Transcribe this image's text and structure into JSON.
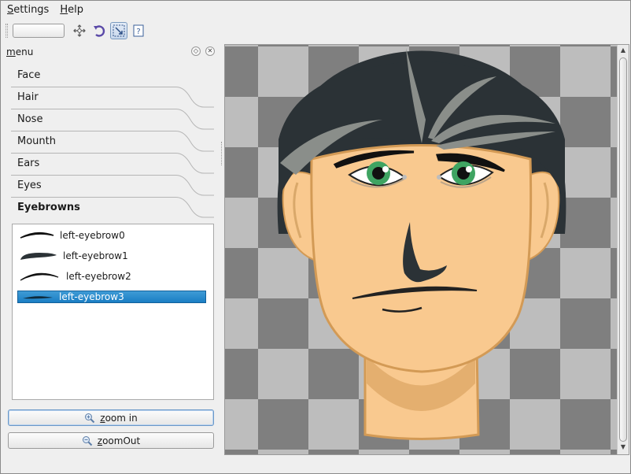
{
  "menubar": {
    "items": [
      "Settings",
      "Help"
    ]
  },
  "toolbar": {
    "combo_value": "",
    "icons": [
      "move-icon",
      "rotate-icon",
      "fit-selection-icon",
      "whats-this-icon"
    ]
  },
  "dock": {
    "title": "menu",
    "tabs": [
      {
        "label": "Face"
      },
      {
        "label": "Hair"
      },
      {
        "label": "Nose"
      },
      {
        "label": "Mounth"
      },
      {
        "label": "Ears"
      },
      {
        "label": "Eyes"
      },
      {
        "label": "Eyebrowns"
      }
    ],
    "active_tab": "Eyebrowns",
    "eyebrows": [
      {
        "label": "left-eyebrow0"
      },
      {
        "label": "left-eyebrow1"
      },
      {
        "label": "left-eyebrow2"
      },
      {
        "label": "left-eyebrow3"
      }
    ],
    "selected_eyebrow": "left-eyebrow3",
    "zoom_in_label": "zoom in",
    "zoom_out_label": "zoomOut"
  },
  "colors": {
    "hair": "#2b3236",
    "hair_highlight": "#8a8e8a",
    "skin": "#f9c98f",
    "skin_outline": "#d39a55",
    "iris": "#3fa462",
    "checker_dark": "#7f7f7f",
    "checker_light": "#bdbdbd",
    "selection": "#1a7ec4"
  }
}
